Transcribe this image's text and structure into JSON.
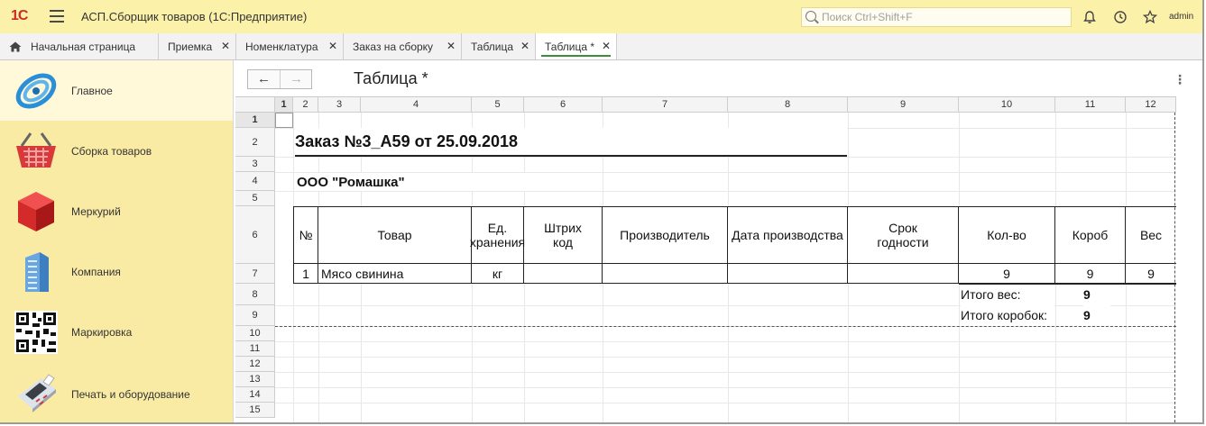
{
  "app": {
    "logo": "1С",
    "title": "АСП.Сборщик товаров  (1С:Предприятие)",
    "search_placeholder": "Поиск Ctrl+Shift+F",
    "user": "admin"
  },
  "tabs": [
    {
      "label": "Начальная страница"
    },
    {
      "label": "Приемка"
    },
    {
      "label": "Номенклатура"
    },
    {
      "label": "Заказ на сборку"
    },
    {
      "label": "Таблица"
    },
    {
      "label": "Таблица *"
    }
  ],
  "sidebar": {
    "items": [
      {
        "label": "Главное"
      },
      {
        "label": "Сборка товаров"
      },
      {
        "label": "Меркурий"
      },
      {
        "label": "Компания"
      },
      {
        "label": "Маркировка"
      },
      {
        "label": "Печать и оборудование"
      }
    ]
  },
  "document": {
    "title": "Таблица *",
    "nav_back": "←",
    "nav_forward": "→"
  },
  "sheet": {
    "columns": [
      "1",
      "2",
      "3",
      "4",
      "5",
      "6",
      "7",
      "8",
      "9",
      "10",
      "11",
      "12"
    ],
    "rows": [
      "1",
      "2",
      "3",
      "4",
      "5",
      "6",
      "7",
      "8",
      "9",
      "10",
      "11",
      "12",
      "13",
      "14",
      "15"
    ],
    "order_title": "Заказ №3_А59 от 25.09.2018",
    "company": "ООО \"Ромашка\"",
    "headers": [
      "№",
      "Товар",
      "Ед. хранения",
      "Штрих код",
      "Производитель",
      "Дата производства",
      "Срок годности",
      "Кол-во",
      "Короб",
      "Вес"
    ],
    "row": {
      "num": "1",
      "item": "Мясо свинина",
      "unit": "кг",
      "barcode": "",
      "maker": "",
      "date": "",
      "shelf": "",
      "qty": "9",
      "box": "9",
      "weight": "9"
    },
    "total_weight_label": "Итого вес:",
    "total_weight": "9",
    "total_boxes_label": "Итого коробок:",
    "total_boxes": "9"
  }
}
